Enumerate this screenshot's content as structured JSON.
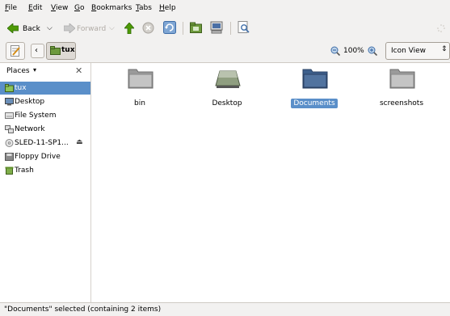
{
  "menubar": {
    "items": [
      {
        "label": "File",
        "mnemonic": "F",
        "rest": "ile"
      },
      {
        "label": "Edit",
        "mnemonic": "E",
        "rest": "dit"
      },
      {
        "label": "View",
        "mnemonic": "V",
        "rest": "iew"
      },
      {
        "label": "Go",
        "mnemonic": "G",
        "rest": "o"
      },
      {
        "label": "Bookmarks",
        "mnemonic": "B",
        "rest": "ookmarks"
      },
      {
        "label": "Tabs",
        "mnemonic": "T",
        "rest": "abs"
      },
      {
        "label": "Help",
        "mnemonic": "H",
        "rest": "elp"
      }
    ]
  },
  "toolbar": {
    "back_label": "Back",
    "forward_label": "Forward",
    "icons": [
      "back-arrow-icon",
      "forward-arrow-icon",
      "up-arrow-icon",
      "stop-icon",
      "reload-icon",
      "home-folder-icon",
      "computer-icon",
      "search-icon"
    ]
  },
  "locationbar": {
    "path_button": "tux",
    "zoom_level": "100%",
    "view_mode": "Icon View"
  },
  "sidebar": {
    "header": "Places",
    "items": [
      {
        "label": "tux",
        "icon": "home-folder-icon",
        "selected": true
      },
      {
        "label": "Desktop",
        "icon": "desktop-icon",
        "selected": false
      },
      {
        "label": "File System",
        "icon": "harddisk-icon",
        "selected": false
      },
      {
        "label": "Network",
        "icon": "network-icon",
        "selected": false
      },
      {
        "label": "SLED-11-SP1...",
        "icon": "cdrom-icon",
        "selected": false
      },
      {
        "label": "Floppy Drive",
        "icon": "floppy-icon",
        "selected": false
      },
      {
        "label": "Trash",
        "icon": "trash-icon",
        "selected": false
      }
    ]
  },
  "content": {
    "files": [
      {
        "label": "bin",
        "icon": "folder-icon",
        "selected": false
      },
      {
        "label": "Desktop",
        "icon": "desktop-folder-icon",
        "selected": false
      },
      {
        "label": "Documents",
        "icon": "documents-folder-icon",
        "selected": true
      },
      {
        "label": "screenshots",
        "icon": "folder-icon",
        "selected": false
      }
    ]
  },
  "status": {
    "text": "\"Documents\" selected (containing 2 items)"
  },
  "colors": {
    "selection": "#5a8fc9",
    "chrome": "#f2f1f0"
  }
}
